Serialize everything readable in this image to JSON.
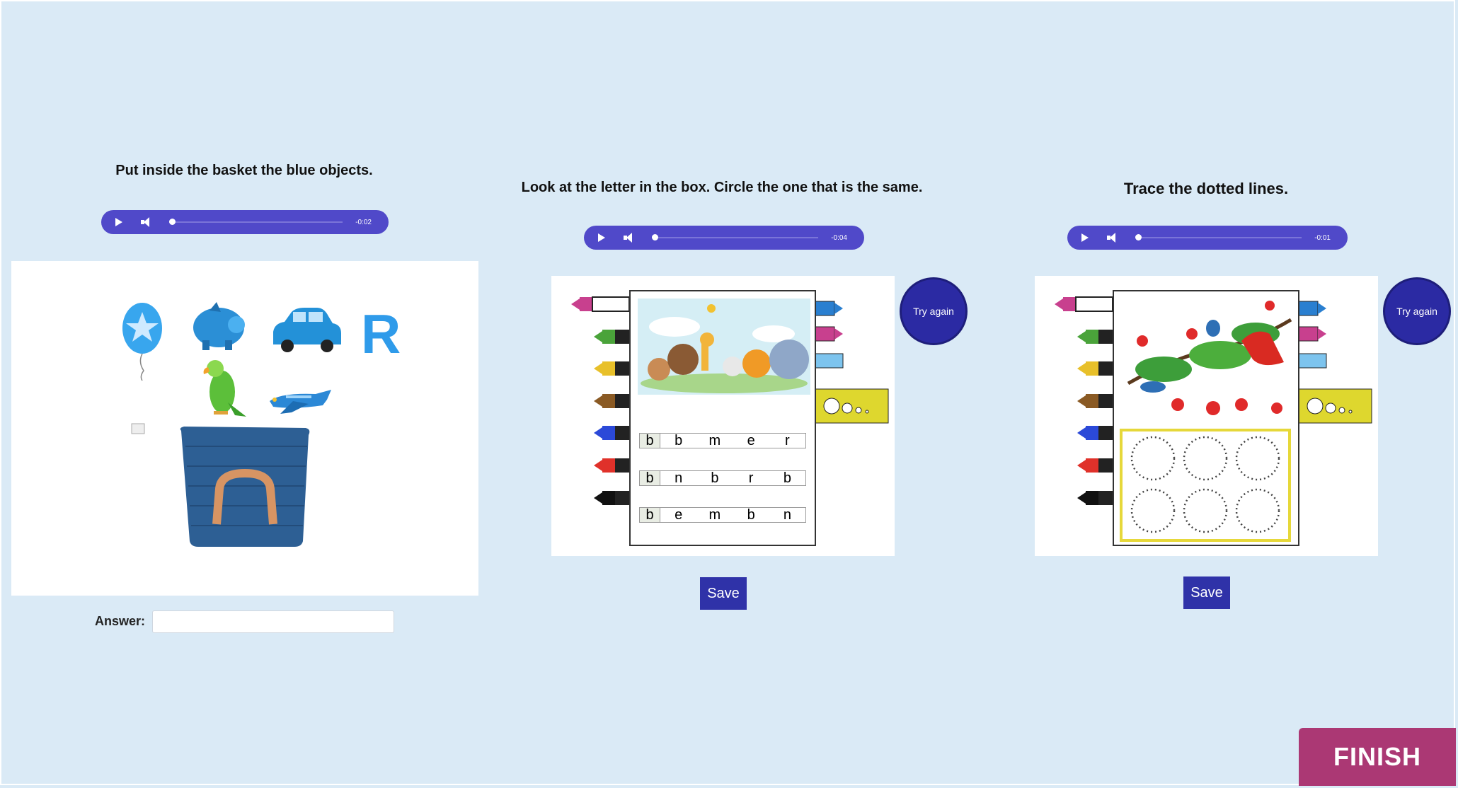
{
  "activities": [
    {
      "instruction": "Put inside the basket the blue objects.",
      "audio": {
        "time": "-0:02"
      },
      "answer_label": "Answer:",
      "answer_value": ""
    },
    {
      "instruction": "Look at the letter in the box. Circle the one that is the same.",
      "audio": {
        "time": "-0:04"
      },
      "try_again_label": "Try again",
      "save_label": "Save",
      "rows": [
        {
          "target": "b",
          "options": [
            "b",
            "m",
            "e",
            "r"
          ]
        },
        {
          "target": "b",
          "options": [
            "n",
            "b",
            "r",
            "b"
          ]
        },
        {
          "target": "b",
          "options": [
            "e",
            "m",
            "b",
            "n"
          ]
        }
      ]
    },
    {
      "instruction": "Trace the dotted lines.",
      "audio": {
        "time": "-0:01"
      },
      "try_again_label": "Try again",
      "save_label": "Save"
    }
  ],
  "finish_label": "FINISH",
  "colors": {
    "background": "#daeaf6",
    "audio": "#5049c9",
    "button": "#2f32a8",
    "finish": "#ab3874"
  }
}
